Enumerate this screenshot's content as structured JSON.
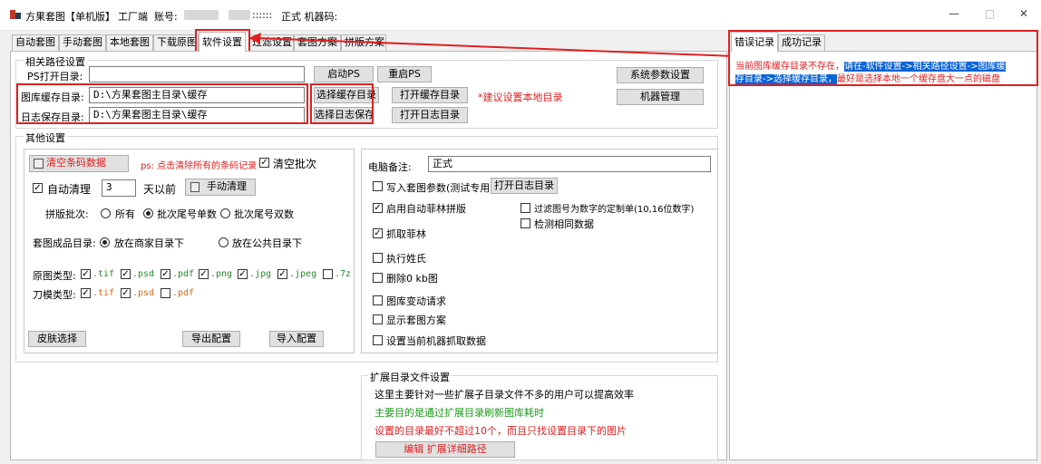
{
  "colors": {
    "accent_red": "#e02020",
    "highlight": "#0a64d8",
    "green": "#1a9a1a"
  },
  "titlebar": {
    "app_title": "方果套图【单机版】",
    "mode": "工厂端",
    "account_label": "账号:",
    "dots": "::::::",
    "machine_label": "正式 机器码:",
    "minimize": "—",
    "maximize": "□",
    "close": "✕"
  },
  "tabs": [
    {
      "label": "自动套图"
    },
    {
      "label": "手动套图"
    },
    {
      "label": "本地套图"
    },
    {
      "label": "下载原图"
    },
    {
      "label": "软件设置"
    },
    {
      "label": "过滤设置"
    },
    {
      "label": "套图方案"
    },
    {
      "label": "拼版方案"
    }
  ],
  "path_settings": {
    "group_title": "相关路径设置",
    "ps_open_label": "PS打开目录:",
    "ps_open_value": "",
    "cache_label": "图库缓存目录:",
    "cache_value": "D:\\方果套图主目录\\缓存",
    "log_label": "日志保存目录:",
    "log_value": "D:\\方果套图主目录\\缓存",
    "start_ps": "启动PS",
    "restart_ps": "重启PS",
    "choose_cache": "选择缓存目录",
    "open_cache": "打开缓存目录",
    "choose_log": "选择日志保存",
    "open_log": "打开日志目录",
    "hint": "*建议设置本地目录",
    "system_params": "系统参数设置",
    "machine_manage": "机器管理"
  },
  "other": {
    "group_title": "其他设置",
    "clear_barcode": "清空条码数据",
    "clear_barcode_hint": "ps: 点击清除所有的条码记录",
    "clear_batch": "清空批次",
    "auto_clean": "自动清理",
    "days_value": "3",
    "days_before": "天以前",
    "manual_clean": "手动清理",
    "batch_label": "拼版批次:",
    "batch_opts": [
      "所有",
      "批次尾号单数",
      "批次尾号双数"
    ],
    "output_dir_label": "套图成品目录:",
    "output_opts": [
      "放在商家目录下",
      "放在公共目录下"
    ],
    "orig_type_label": "原图类型:",
    "orig_types": [
      ".tif",
      ".psd",
      ".pdf",
      ".png",
      ".jpg",
      ".jpeg",
      ".7z"
    ],
    "knife_type_label": "刀模类型:",
    "knife_types": [
      ".tif",
      ".psd",
      ".pdf"
    ],
    "skin": "皮肤选择",
    "export_cfg": "导出配置",
    "import_cfg": "导入配置"
  },
  "right": {
    "pc_note_label": "电脑备注:",
    "pc_note_value": "正式",
    "write_params": "写入套图参数(测试专用)",
    "open_log_dir": "打开日志目录",
    "auto_felin": "启用自动菲林拼版",
    "filter_num": "过滤图号为数字的定制单(10,16位数字)",
    "detect_same": "检测相同数据",
    "grab_felin": "抓取菲林",
    "exec_name": "执行姓氏",
    "delete_0kb": "删除0 kb图",
    "lib_change": "图库变动请求",
    "show_scheme": "显示套图方案",
    "set_machine": "设置当前机器抓取数据"
  },
  "ext_dir": {
    "group_title": "扩展目录文件设置",
    "line1": "这里主要针对一些扩展子目录文件不多的用户可以提高效率",
    "line2": "主要目的是通过扩展目录刷新图库耗时",
    "line3": "设置的目录最好不超过10个，而且只找设置目录下的图片",
    "edit_btn": "编辑 扩展详细路径"
  },
  "log_panel": {
    "tab_error": "错误记录",
    "tab_success": "成功记录",
    "msg_part1": "当前图库缓存目录不存在，",
    "msg_hl1": "请在-软件设置->相关路径设置->图库缓",
    "msg_hl2": "存目录->选择缓存目录，",
    "msg_part2": "最好是选择本地一个缓存盘大一点的磁盘"
  }
}
